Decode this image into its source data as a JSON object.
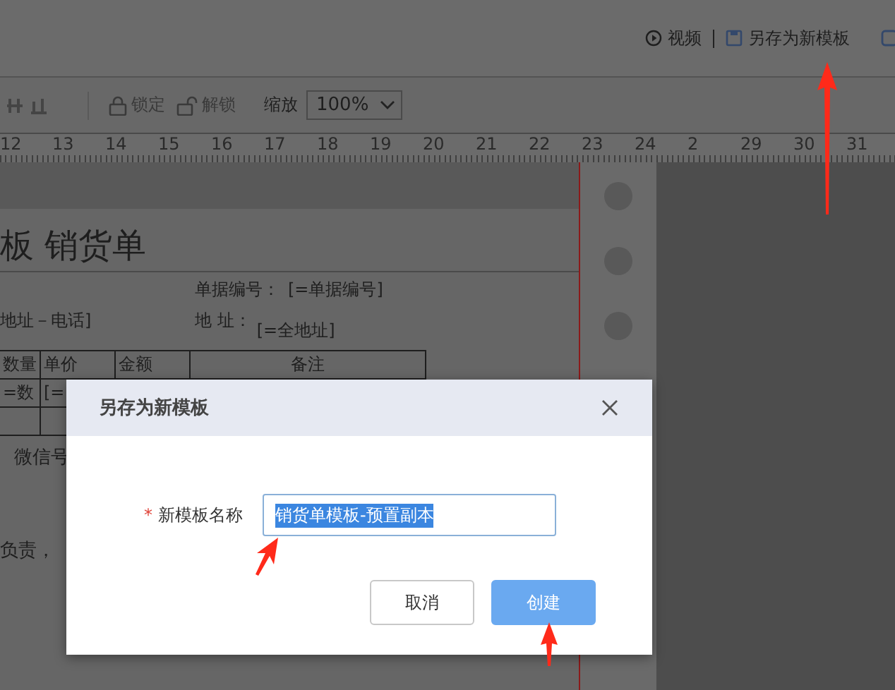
{
  "header": {
    "links": [
      {
        "label": "视频",
        "kind": "video"
      },
      {
        "label": "另存为新模板",
        "kind": "save"
      }
    ]
  },
  "toolbar": {
    "items": [
      {
        "label": "锁定",
        "kind": "lock",
        "disabled": true
      },
      {
        "label": "解锁",
        "kind": "unlock",
        "disabled": true
      }
    ],
    "zoom_label": "缩放",
    "zoom_value": "100%"
  },
  "ruler": {
    "numbers": [
      "12",
      "13",
      "14",
      "15",
      "16",
      "17",
      "18",
      "19",
      "20",
      "21",
      "22",
      "23",
      "24",
      "2",
      "29",
      "30",
      "31"
    ]
  },
  "document": {
    "title": "板 销货单",
    "number_label": "单据编号：",
    "number_value": "[=单据编号]",
    "contact_value": "地址－电话]",
    "address_label": "地 址：",
    "address_value": "[=全地址]",
    "table": {
      "columns": [
        "数量",
        "单价",
        "金额",
        "备注"
      ],
      "rows": [
        [
          "=数",
          "[="
        ]
      ]
    },
    "notes": [
      "微信号",
      "负责，"
    ]
  },
  "dialog": {
    "title": "另存为新模板",
    "field": {
      "label": "新模板名称",
      "required": true,
      "required_mark": "*",
      "value": "销货单模板-预置副本",
      "text_selected": true
    },
    "buttons": [
      {
        "label": "取消",
        "kind": "secondary"
      },
      {
        "label": "创建",
        "kind": "primary"
      }
    ]
  }
}
